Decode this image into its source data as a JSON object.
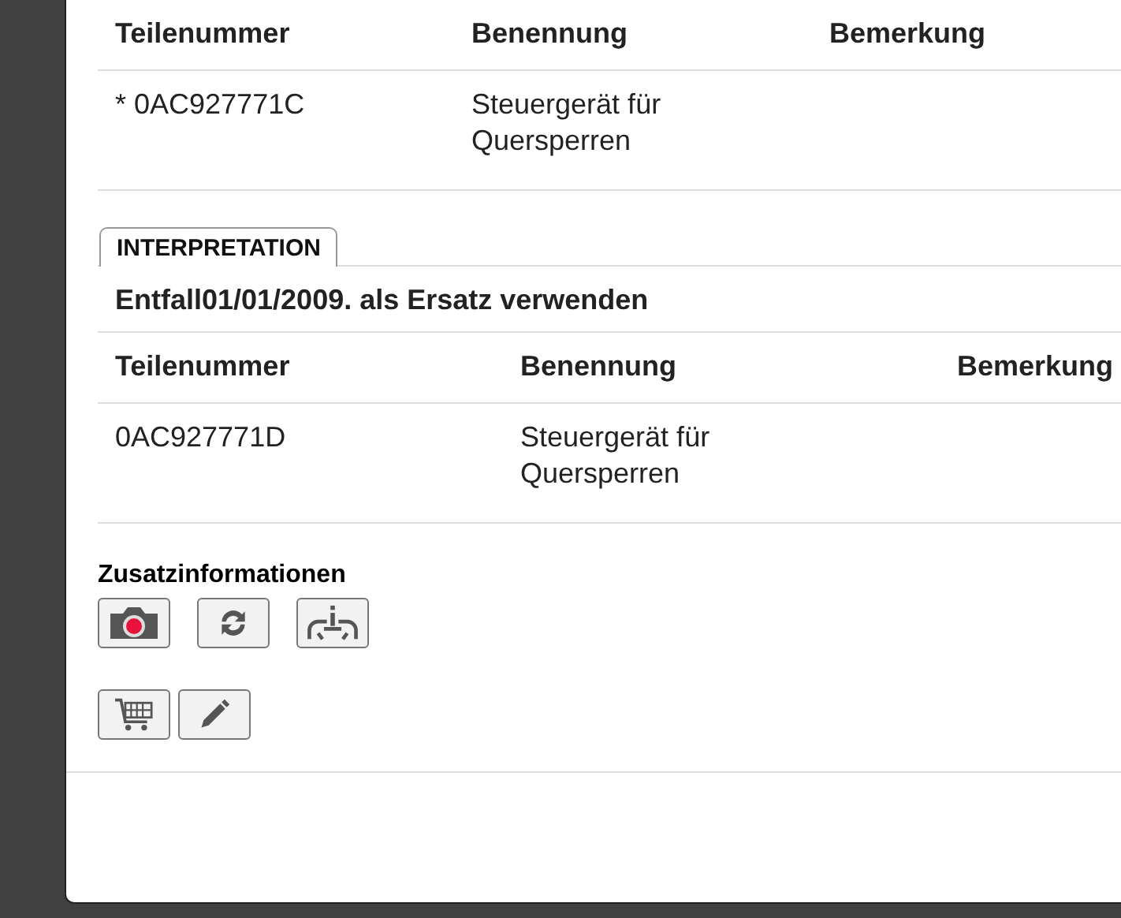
{
  "parts_table": {
    "columns": [
      "Teilenummer",
      "Benennung",
      "Bemerkung"
    ],
    "rows": [
      {
        "cells": [
          "* 0AC927771C",
          "Steuergerät für Quersperren"
        ]
      }
    ]
  },
  "interpretation": {
    "tab": {
      "label": "INTERPRETATION",
      "selected": true
    },
    "heading": "Entfall01/01/2009. als Ersatz verwenden",
    "columns": [
      "Teilenummer",
      "Benennung",
      "Bemerkung"
    ],
    "rows": [
      {
        "cells": [
          "0AC927771D",
          "Steuergerät für Quersperren"
        ]
      }
    ]
  },
  "additional_info": {
    "title": "Zusatzinformationen",
    "buttons": [
      {
        "kind": "camera"
      },
      {
        "kind": "refresh"
      },
      {
        "kind": "info"
      }
    ]
  },
  "actions": [
    {
      "kind": "cart"
    },
    {
      "kind": "edit"
    }
  ]
}
